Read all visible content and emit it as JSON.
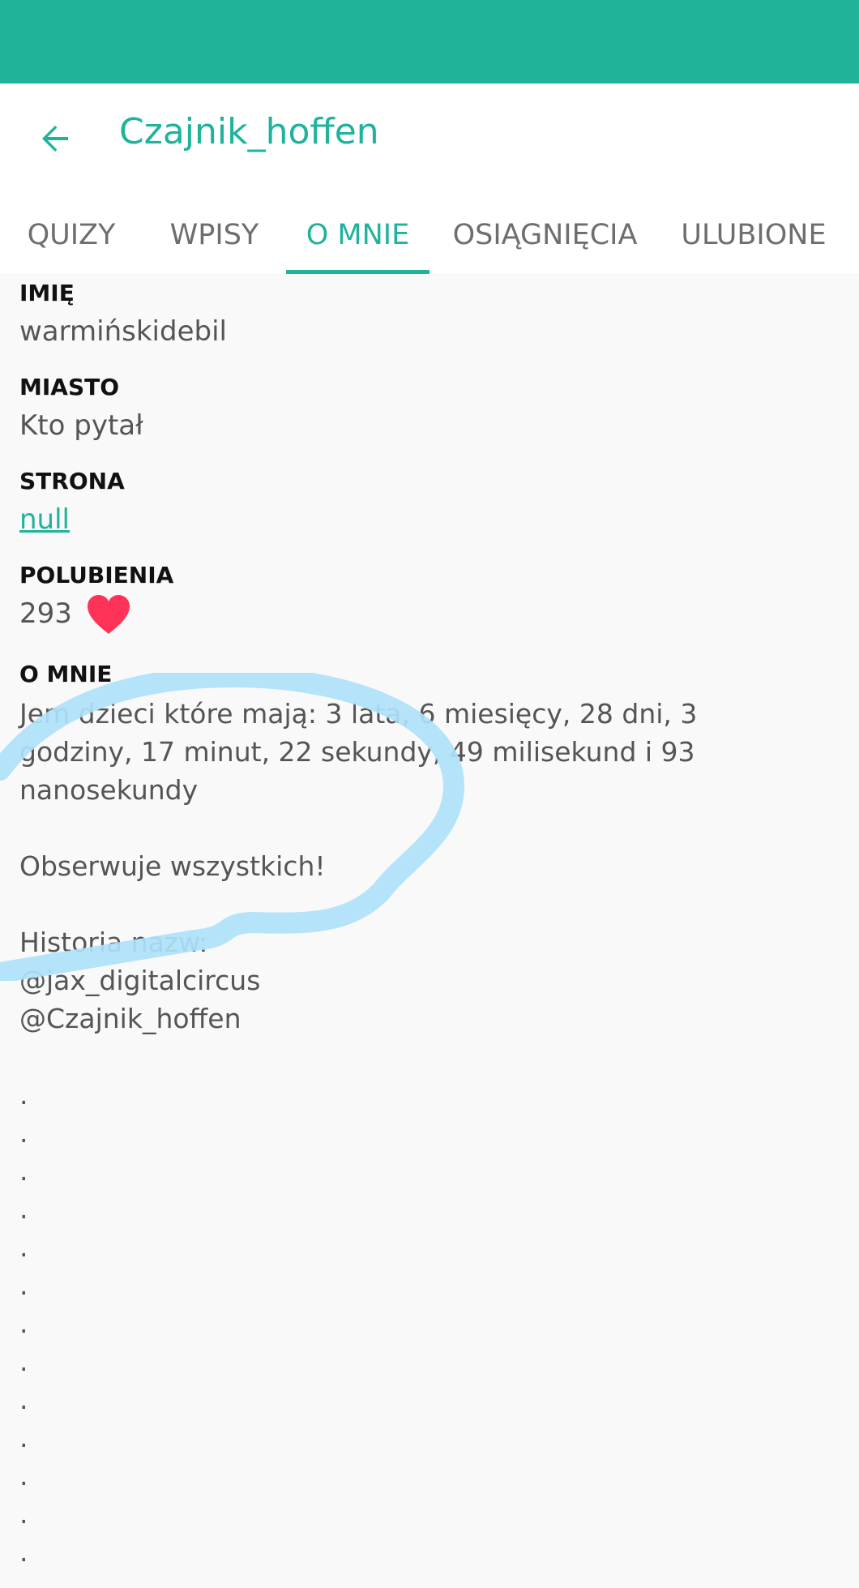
{
  "colors": {
    "accent": "#1fb39b",
    "heart": "#ff3358",
    "scribble": "#aee1fa"
  },
  "header": {
    "back_icon": "arrow-left-icon",
    "title": "Czajnik_hoffen"
  },
  "tabs": [
    {
      "label": "QUIZY",
      "active": false
    },
    {
      "label": "WPISY",
      "active": false
    },
    {
      "label": "O MNIE",
      "active": true
    },
    {
      "label": "OSIĄGNIĘCIA",
      "active": false
    },
    {
      "label": "ULUBIONE",
      "active": false
    }
  ],
  "profile": {
    "name_label": "IMIĘ",
    "name_value": "warmińskidebil",
    "city_label": "MIASTO",
    "city_value": "Kto pytał",
    "website_label": "STRONA",
    "website_value": "null",
    "likes_label": "POLUBIENIA",
    "likes_value": "293",
    "likes_icon": "heart-icon",
    "about_label": "O MNIE",
    "about_text": "Jem dzieci które mają: 3 lata, 6 miesięcy, 28 dni, 3\ngodziny, 17 minut, 22 sekundy, 49 milisekund i 93\nnanosekundy\n\nObserwuje wszystkich!\n\nHistoria nazw:\n@jax_digitalcircus\n@Czajnik_hoffen\n\n.\n.\n.\n.\n.\n.\n.\n.\n.\n.\n.\n.\n."
  }
}
